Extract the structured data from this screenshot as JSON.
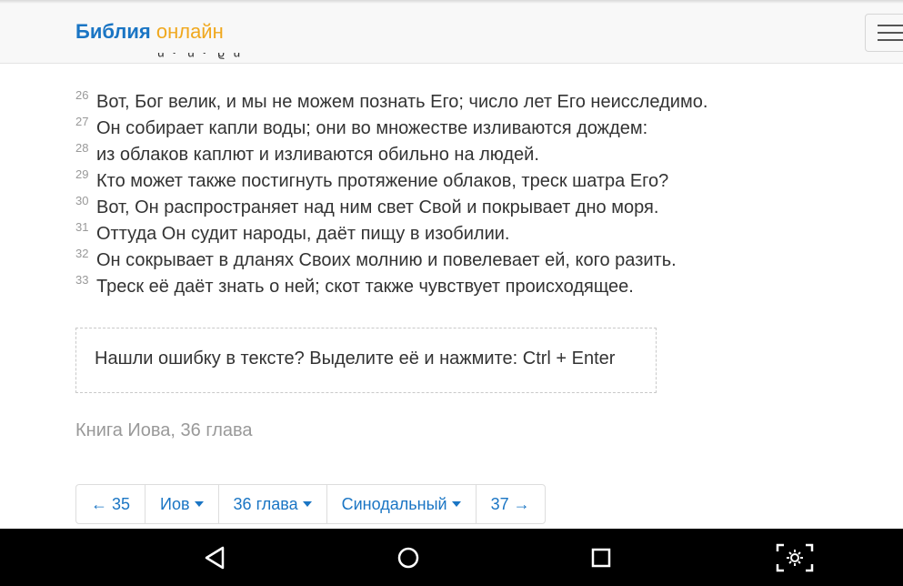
{
  "header": {
    "brand_part1": "Библия",
    "brand_part2": "онлайн",
    "menu_icon": "hamburger-menu-icon"
  },
  "verses": [
    {
      "num": "26",
      "text": "Вот, Бог велик, и мы не можем познать Его; число лет Его неисследимо."
    },
    {
      "num": "27",
      "text": "Он собирает капли воды; они во множестве изливаются дождем:"
    },
    {
      "num": "28",
      "text": "из облаков каплют и изливаются обильно на людей."
    },
    {
      "num": "29",
      "text": "Кто может также постигнуть протяжение облаков, треск шатра Его?"
    },
    {
      "num": "30",
      "text": "Вот, Он распространяет над ним свет Свой и покрывает дно моря."
    },
    {
      "num": "31",
      "text": "Оттуда Он судит народы, даёт пищу в изобилии."
    },
    {
      "num": "32",
      "text": "Он сокрывает в дланях Своих молнию и повелевает ей, кого разить."
    },
    {
      "num": "33",
      "text": "Треск её даёт знать о ней; скот также чувствует происходящее."
    }
  ],
  "notice": {
    "text": "Нашли ошибку в тексте? Выделите её и нажмите: Ctrl + Enter"
  },
  "chapter_caption": "Книга Иова, 36 глава",
  "pager": {
    "prev": "← 35",
    "book": "Иов",
    "chapter": "36 глава",
    "translation": "Синодальный",
    "next": "37 →"
  },
  "system_nav": {
    "back_icon": "back-triangle-icon",
    "home_icon": "home-circle-icon",
    "recents_icon": "recents-square-icon",
    "screenshot_icon": "screenshot-capture-icon"
  },
  "colors": {
    "brand_blue": "#1a75c4",
    "brand_orange": "#f0a81e",
    "muted_text": "#999999",
    "navbar": "#000000"
  }
}
